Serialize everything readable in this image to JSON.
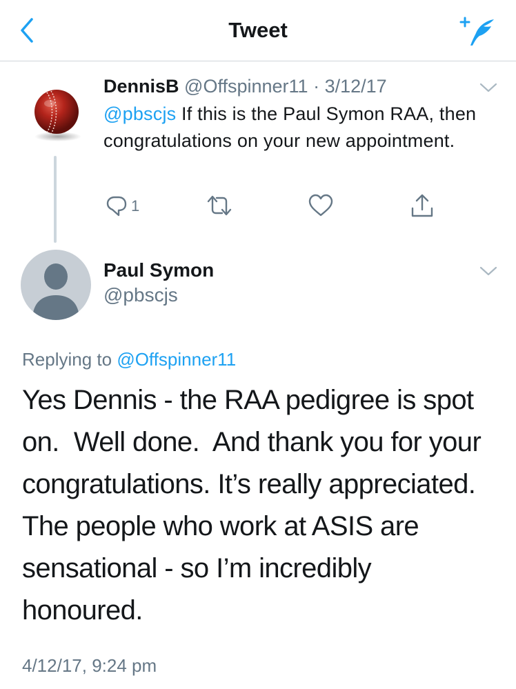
{
  "header": {
    "title": "Tweet",
    "back_icon": "chevron-left-icon",
    "compose_icon": "compose-tweet-icon",
    "accent_color": "#1da1f2"
  },
  "parent_tweet": {
    "display_name": "DennisB",
    "handle": "@Offspinner11",
    "separator": "·",
    "date": "3/12/17",
    "avatar": "cricket-ball-avatar",
    "mention": "@pbscjs",
    "text": "If this is the Paul Symon RAA, then congratulations on your new appointment.",
    "reply_count": "1",
    "action_icons": [
      "reply-icon",
      "retweet-icon",
      "like-icon",
      "share-icon"
    ]
  },
  "main_tweet": {
    "display_name": "Paul Symon",
    "handle": "@pbscjs",
    "avatar": "default-profile-avatar",
    "replying_prefix": "Replying to",
    "replying_to": "@Offspinner11",
    "text_lines": [
      "Yes Dennis - the RAA pedigree is spot",
      "on.  Well done.  And thank you for your",
      "congratulations. It’s really appreciated.",
      "The people who work at ASIS are",
      "sensational - so I’m incredibly",
      "honoured."
    ],
    "timestamp": "4/12/17, 9:24 pm"
  }
}
